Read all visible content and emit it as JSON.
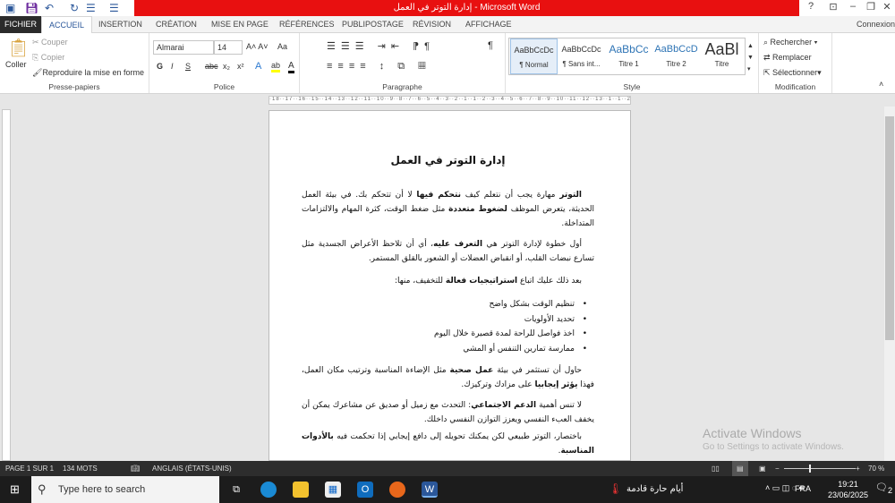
{
  "window": {
    "title": "إدارة التوتر في العمل  -  Microsoft Word",
    "help": "?",
    "connexion": "Connexion"
  },
  "tabs": [
    "FICHIER",
    "ACCUEIL",
    "INSERTION",
    "CRÉATION",
    "MISE EN PAGE",
    "RÉFÉRENCES",
    "PUBLIPOSTAGE",
    "RÉVISION",
    "AFFICHAGE"
  ],
  "clipboard": {
    "paste": "Coller",
    "cut": "Couper",
    "copy": "Copier",
    "format_painter": "Reproduire la mise en forme",
    "label": "Presse-papiers"
  },
  "font": {
    "name": "Almarai",
    "size": "14",
    "label": "Police",
    "bold": "G",
    "italic": "I",
    "underline": "S",
    "strike": "abc",
    "sub": "x₂",
    "sup": "x²",
    "case": "Aa"
  },
  "paragraph": {
    "label": "Paragraphe",
    "pilcrow": "¶"
  },
  "styles": {
    "label": "Style",
    "items": [
      {
        "preview": "AaBbCcDc",
        "name": "¶ Normal"
      },
      {
        "preview": "AaBbCcDc",
        "name": "¶ Sans int..."
      },
      {
        "preview": "AaBbCc",
        "name": "Titre 1"
      },
      {
        "preview": "AaBbCcD",
        "name": "Titre 2"
      },
      {
        "preview": "AaBl",
        "name": "Titre"
      }
    ]
  },
  "editing": {
    "label": "Modification",
    "find": "Rechercher",
    "replace": "Remplacer",
    "select": "Sélectionner"
  },
  "ruler": "·18··17··16··15··14··13··12··11··10··9··8··7··6··5··4··3··2··1··1··2··3··4··5··6··7··8··9··10··11··12··13··1··1··2·",
  "document": {
    "title": "إدارة التوتر في العمل",
    "p1_bold1": "التوتر",
    "p1_a": " مهارة يجب أن نتعلم كيف ",
    "p1_bold2": "نتحكم فيها",
    "p1_b": " لا أن تتحكم بك. في بيئة العمل الحديثة، يتعرض الموظف ",
    "p1_bold3": "لضغوط متعددة",
    "p1_c": " مثل ضغط الوقت، كثرة المهام والالتزامات المتداخلة.",
    "p2_a": "أول خطوة لإدارة التوتر هي ",
    "p2_bold": "التعرف عليه",
    "p2_b": "، أي أن تلاحظ الأعراض الجسدية مثل تسارع نبضات القلب، أو انقباض العضلات أو الشعور بالقلق المستمر.",
    "p3_a": "بعد ذلك عليك اتباع ",
    "p3_bold": "استراتيجيات فعالة",
    "p3_b": " للتخفيف، منها:",
    "bullets": [
      "تنظيم الوقت بشكل واضح",
      "تحديد الأولويات",
      "اخذ فواصل للراحة لمدة قصيرة خلال اليوم",
      "ممارسة تمارين التنفس أو المشي"
    ],
    "p4_a": "حاول أن تستثمر في بيئة ",
    "p4_bold1": "عمل صحية",
    "p4_b": " مثل الإضاءة المناسبة وترتيب مكان العمل، فهذا ",
    "p4_bold2": "يؤثر إيجابيا",
    "p4_c": " على مزادك وتركيزك.",
    "p5_a": "لا تنس أهمية ",
    "p5_bold": "الدعم الاجتماعي",
    "p5_b": ": التحدث مع زميل أو صديق عن مشاعرك يمكن أن يخفف العبء النفسي ويعزز التوازن النفسي داخلك.",
    "p6_a": "باختصار، التوتر طبيعي لكن يمكنك تحويله إلى دافع إيجابي إذا تحكمت فيه ",
    "p6_bold": "بالأدوات المناسبة",
    "p6_b": "."
  },
  "status": {
    "page": "PAGE 1 SUR 1",
    "words": "134 MOTS",
    "language": "ANGLAIS (ÉTATS-UNIS)",
    "zoom": "70 %",
    "zoom_value": 70
  },
  "watermark": {
    "title": "Activate Windows",
    "sub": "Go to Settings to activate Windows."
  },
  "taskbar": {
    "search_placeholder": "Type here to search",
    "weather": "أيام حارة قادمة",
    "lang": "FRA",
    "time": "19:21",
    "date": "23/06/2025",
    "notifications": "2"
  }
}
